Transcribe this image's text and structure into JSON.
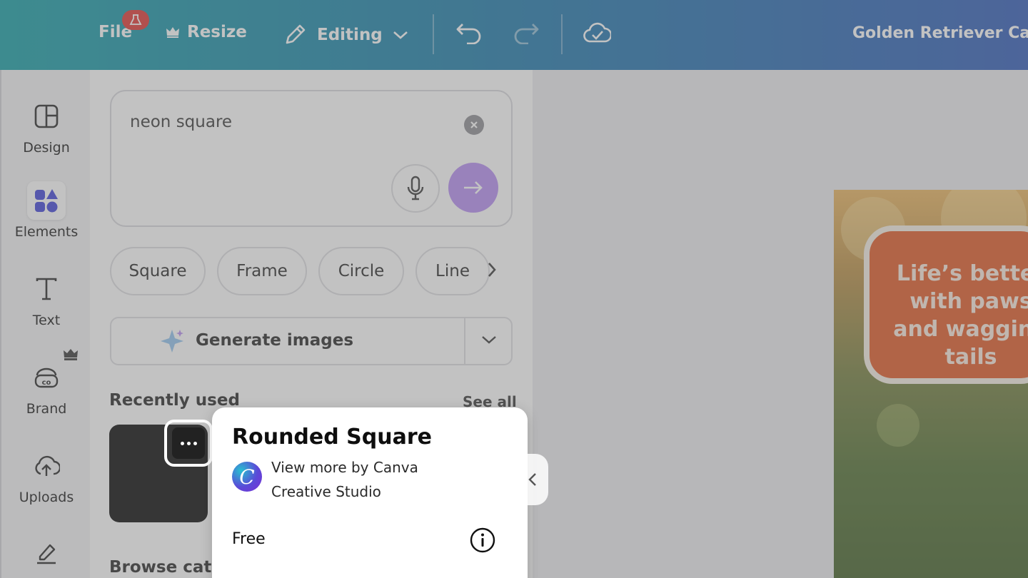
{
  "topbar": {
    "file_label": "File",
    "resize_label": "Resize",
    "editing_label": "Editing",
    "doc_title": "Golden Retriever Cat"
  },
  "rail": {
    "items": [
      {
        "label": "Design",
        "icon": "layout-icon"
      },
      {
        "label": "Elements",
        "icon": "shapes-icon"
      },
      {
        "label": "Text",
        "icon": "text-icon"
      },
      {
        "label": "Brand",
        "icon": "brand-icon"
      },
      {
        "label": "Uploads",
        "icon": "cloud-upload-icon"
      },
      {
        "label": "",
        "icon": "draw-icon"
      }
    ]
  },
  "panel": {
    "search_value": "neon square",
    "chips": [
      "Square",
      "Frame",
      "Circle",
      "Line"
    ],
    "generate_label": "Generate images",
    "recent_title": "Recently used",
    "see_all": "See all",
    "browse_title": "Browse cate"
  },
  "popover": {
    "title": "Rounded Square",
    "creator_link": "View more by Canva Creative Studio",
    "price": "Free"
  },
  "canvas": {
    "bubble_text": "Life’s better with paws and wagging tails"
  },
  "colors": {
    "accent_purple": "#b58bf3",
    "topbar_start": "#0e9ca3",
    "topbar_end": "#2a56b6",
    "bubble_orange": "#e0551f"
  }
}
